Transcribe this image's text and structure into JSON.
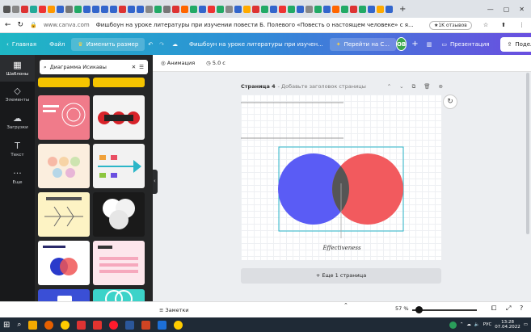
{
  "browser": {
    "url": "www.canva.com",
    "page_title": "Фишбоун на уроке литературы при изучении повести Б. Полевого «Повесть о настоящем человеке» с я...",
    "reviews_badge": "★1K отзывов"
  },
  "canva_topbar": {
    "home": "Главная",
    "file": "Файл",
    "resize": "Изменить размер",
    "doc_title": "Фишбоун на уроке литературы при изучен...",
    "goto": "Перейти на С...",
    "avatar": "ОВ",
    "plus": "+",
    "present": "Презентация",
    "share": "Поделиться"
  },
  "left_rail": {
    "items": [
      {
        "label": "Шаблоны",
        "icon": "templates-icon",
        "glyph": "▦"
      },
      {
        "label": "Элементы",
        "icon": "elements-icon",
        "glyph": "◇"
      },
      {
        "label": "Загрузки",
        "icon": "upload-icon",
        "glyph": "☁"
      },
      {
        "label": "Текст",
        "icon": "text-icon",
        "glyph": "T"
      },
      {
        "label": "Еще",
        "icon": "more-icon",
        "glyph": "···"
      }
    ]
  },
  "templates_panel": {
    "search_value": "Диаграмма Исикавы"
  },
  "editor_toolbar": {
    "animation": "Анимация",
    "duration": "5.0 с"
  },
  "page_header": {
    "page_label": "Страница 4",
    "subtitle": "- Добавьте заголовок страницы"
  },
  "diagram": {
    "label": "Effectiveness",
    "left_circle_color": "#5a5cf5",
    "right_circle_color": "#f25a5e",
    "overlap_color": "#555555"
  },
  "add_page": "+ Еще 1 страница",
  "bottom": {
    "notes": "Заметки",
    "zoom": "57 %"
  },
  "taskbar": {
    "lang": "РУС",
    "time": "13:28",
    "date": "07.04.2022"
  }
}
